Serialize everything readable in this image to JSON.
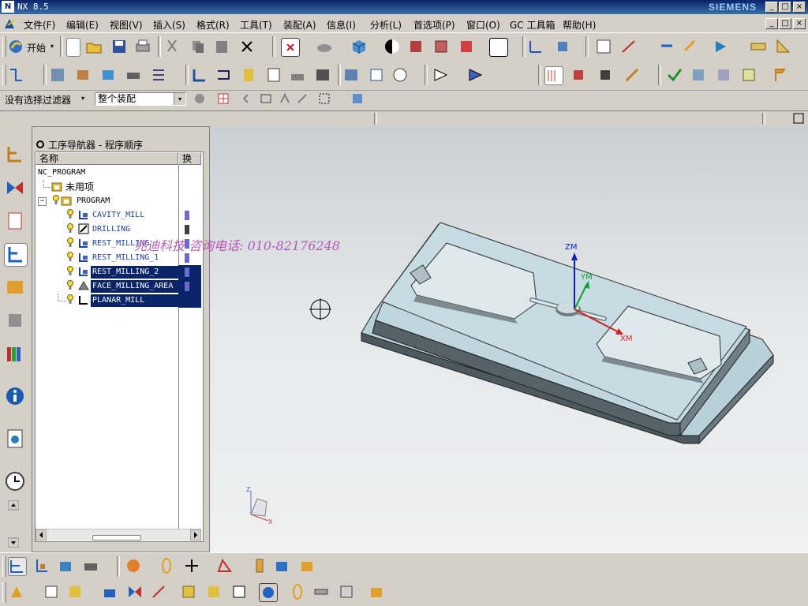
{
  "window": {
    "title": "NX 8.5",
    "brand": "SIEMENS",
    "controls": [
      "_",
      "□",
      "×"
    ]
  },
  "menu": {
    "items": [
      "文件(F)",
      "编辑(E)",
      "视图(V)",
      "插入(S)",
      "格式(R)",
      "工具(T)",
      "装配(A)",
      "信息(I)",
      "分析(L)",
      "首选项(P)",
      "窗口(O)",
      "GC 工具箱",
      "帮助(H)"
    ]
  },
  "toolbar": {
    "start_label": "开始"
  },
  "selection": {
    "filter": "没有选择过滤器",
    "scope": "整个装配"
  },
  "navigator": {
    "title": "工序导航器 - 程序顺序",
    "col_name": "名称",
    "col_change": "换",
    "rows": [
      {
        "label": "NC_PROGRAM"
      },
      {
        "label": "未用项"
      },
      {
        "label": "PROGRAM"
      },
      {
        "label": "CAVITY_MILL"
      },
      {
        "label": "DRILLING"
      },
      {
        "label": "REST_MILLING"
      },
      {
        "label": "REST_MILLING_1"
      },
      {
        "label": "REST_MILLING_2"
      },
      {
        "label": "FACE_MILLING_AREA"
      },
      {
        "label": "PLANAR_MILL"
      }
    ]
  },
  "viewport": {
    "axis_labels": {
      "zm": "ZM",
      "ym": "YM",
      "xm": "XM"
    },
    "triad": {
      "z": "Z",
      "x": "X"
    }
  },
  "watermark": "兆迪科技  咨询电话: 010-82176248",
  "colors": {
    "title_bar": "#0a246a",
    "selection": "#0a246a",
    "part_top": "#b9d2da",
    "part_side": "#4c5a60"
  }
}
